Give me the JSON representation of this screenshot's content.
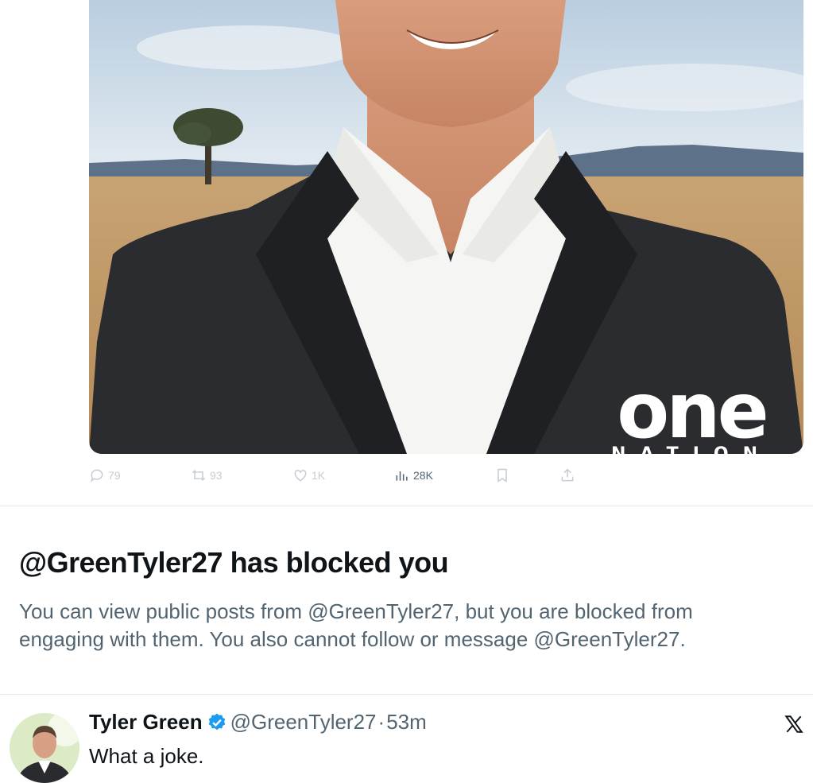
{
  "post": {
    "media": {
      "logo_word": "one",
      "logo_sub": "NATION"
    },
    "actions": {
      "replies": "79",
      "reposts": "93",
      "likes": "1K",
      "views": "28K"
    }
  },
  "block_notice": {
    "title": "@GreenTyler27 has blocked you",
    "body": "You can view public posts from @GreenTyler27, but you are blocked from engaging with them. You also cannot follow or message @GreenTyler27."
  },
  "reply": {
    "name": "Tyler Green",
    "handle": "@GreenTyler27",
    "separator": "·",
    "time": "53m",
    "text": "What a joke."
  },
  "colors": {
    "verified": "#1d9bf0",
    "secondary_text": "#536471",
    "disabled_action": "#c6ccd1"
  },
  "icons": [
    "reply-icon",
    "repost-icon",
    "like-icon",
    "views-icon",
    "bookmark-icon",
    "share-icon",
    "verified-badge-icon",
    "x-logo-icon"
  ]
}
